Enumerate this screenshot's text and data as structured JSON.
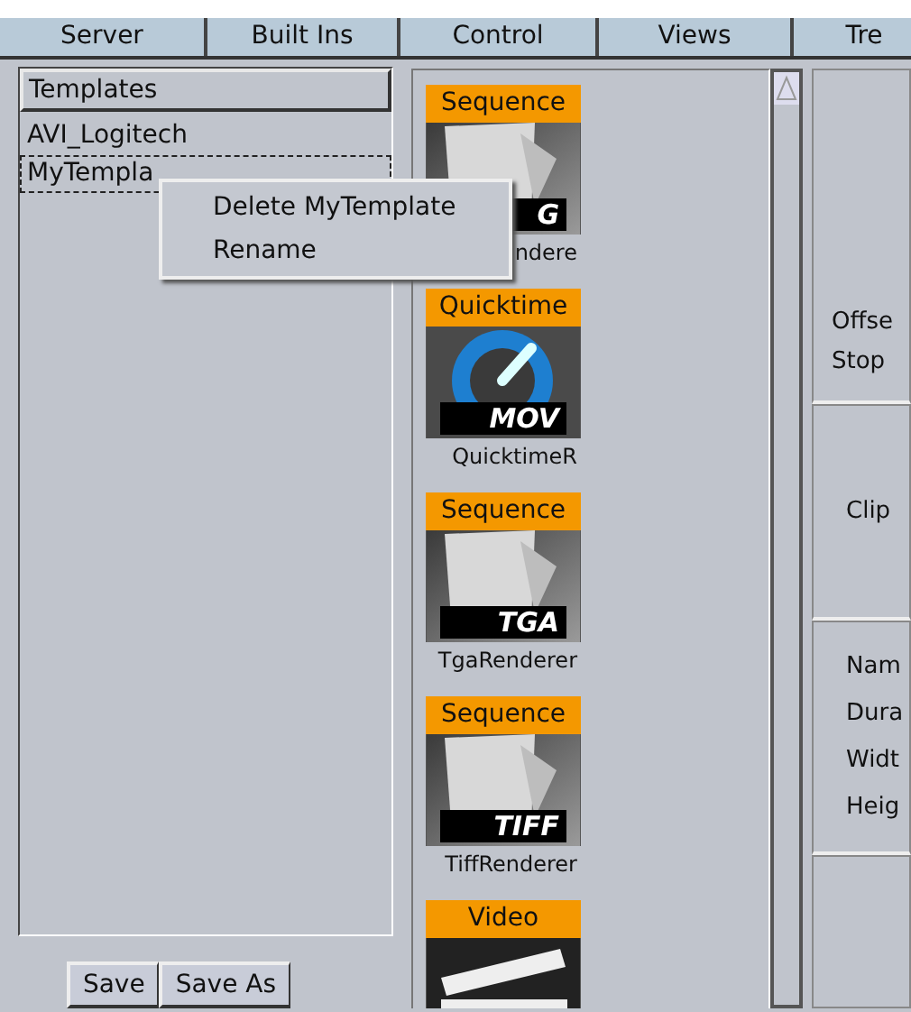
{
  "tabs": [
    {
      "label": "Server",
      "selected": false
    },
    {
      "label": "Built Ins",
      "selected": false
    },
    {
      "label": "Control",
      "selected": false
    },
    {
      "label": "Views",
      "selected": false
    },
    {
      "label": "Tre",
      "selected": false
    }
  ],
  "templates": {
    "header": "Templates",
    "items": [
      {
        "label": "AVI_Logitech",
        "selected": false
      },
      {
        "label": "MyTempla",
        "selected": true
      }
    ]
  },
  "context_menu": {
    "items": [
      "Delete MyTemplate",
      "Rename"
    ]
  },
  "buttons": [
    "Save",
    "Save As"
  ],
  "renderers": [
    {
      "kind": "sequence",
      "category": "Sequence",
      "badge": "G",
      "caption": "ndere"
    },
    {
      "kind": "quicktime",
      "category": "Quicktime",
      "badge": "MOV",
      "caption": "QuicktimeR"
    },
    {
      "kind": "sequence",
      "category": "Sequence",
      "badge": "TGA",
      "caption": "TgaRenderer"
    },
    {
      "kind": "sequence",
      "category": "Sequence",
      "badge": "TIFF",
      "caption": "TiffRenderer"
    },
    {
      "kind": "video",
      "category": "Video"
    }
  ],
  "properties": {
    "sections": [
      [
        "Offse",
        "Stop"
      ],
      [
        "Clip"
      ],
      [
        "Nam",
        "Dura",
        "Widt",
        "Heig"
      ]
    ]
  }
}
